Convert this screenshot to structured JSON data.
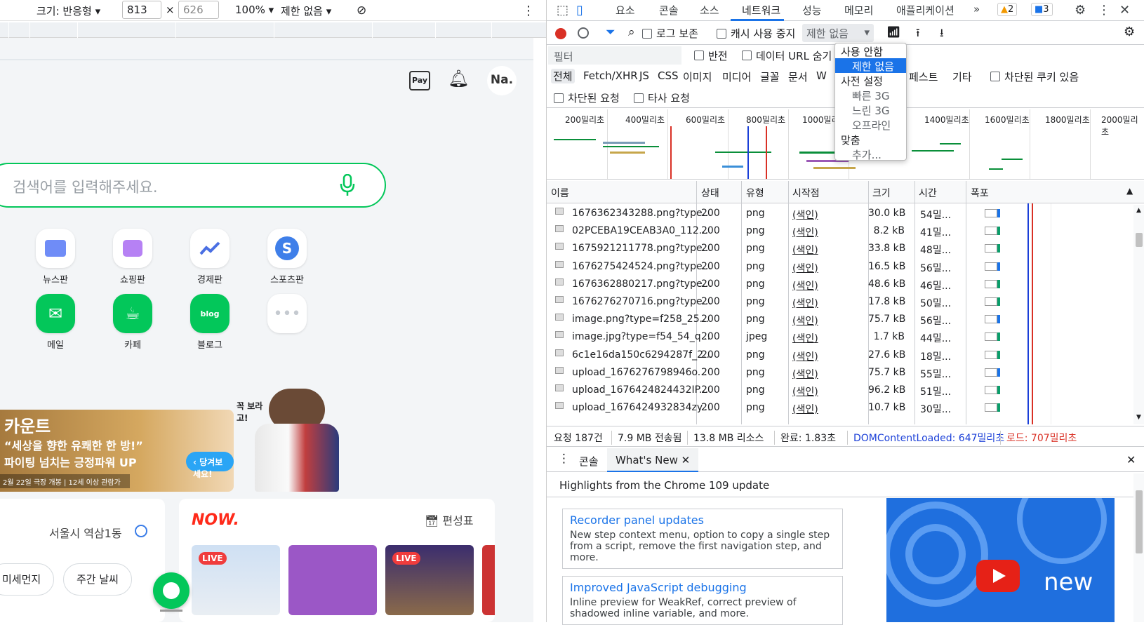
{
  "device_toolbar": {
    "size_label": "크기: 반응형",
    "width": "813",
    "x": "×",
    "height": "626",
    "zoom": "100%",
    "throttle": "제한 없음"
  },
  "page": {
    "pay_label": "Pay",
    "profile": "Na.",
    "search_placeholder": "검색어를 입력해주세요.",
    "apps": [
      {
        "label": "뉴스판",
        "icon": "news-icon"
      },
      {
        "label": "쇼핑판",
        "icon": "shopping-bag-icon"
      },
      {
        "label": "경제판",
        "icon": "chart-icon"
      },
      {
        "label": "스포츠판",
        "icon": "sports-icon"
      },
      {
        "label": "메일",
        "icon": "mail-icon"
      },
      {
        "label": "카페",
        "icon": "cafe-icon"
      },
      {
        "label": "블로그",
        "icon": "blog-icon"
      },
      {
        "label": "",
        "icon": "more-icon"
      }
    ],
    "banner": {
      "brand": "카운트",
      "line1": "“세상을 향한 유쾌한 한 방!”",
      "line2": "파이팅 넘치는 긍정파워 UP",
      "footer": "2월 22일 극장 개봉 | 12세 이상 관람가",
      "cta": "당겨보세요!",
      "side": "꼭 보라고!"
    },
    "weather": {
      "location": "서울시 역삼1동",
      "btn1": "미세먼지",
      "btn2": "주간 날씨"
    },
    "now": {
      "logo": "NOW.",
      "schedule": "편성표",
      "live": "LIVE"
    }
  },
  "devtools": {
    "tabs": [
      "요소",
      "콘솔",
      "소스",
      "네트워크",
      "성능",
      "메모리",
      "애플리케이션"
    ],
    "warnings": "2",
    "messages": "3",
    "netbar": {
      "preserve_log": "로그 보존",
      "disable_cache": "캐시 사용 중지",
      "throttle": "제한 없음"
    },
    "filter": {
      "placeholder": "필터",
      "invert": "반전",
      "hide_data": "데이터 URL 숨기"
    },
    "types": [
      "전체",
      "Fetch/XHR",
      "JS",
      "CSS",
      "이미지",
      "미디어",
      "글꼴",
      "문서",
      "W"
    ],
    "types_tail": [
      "페스트",
      "기타"
    ],
    "blocked_cookies": "차단된 쿠키 있음",
    "blocked_requests": "차단된 요청",
    "third_party": "타사 요청",
    "timeline_ticks": [
      "200밀리초",
      "400밀리초",
      "600밀리초",
      "800밀리초",
      "1000밀리초",
      "1400밀리초",
      "1600밀리초",
      "1800밀리초",
      "2000밀리초"
    ],
    "columns": [
      "이름",
      "상태",
      "유형",
      "시작점",
      "크기",
      "시간",
      "폭포"
    ],
    "rows": [
      {
        "name": "1676362343288.png?type...",
        "status": "200",
        "type": "png",
        "initiator": "(색인)",
        "size": "30.0 kB",
        "time": "54밀..."
      },
      {
        "name": "02PCEBA19CEAB3A0_112...",
        "status": "200",
        "type": "png",
        "initiator": "(색인)",
        "size": "8.2 kB",
        "time": "41밀..."
      },
      {
        "name": "1675921211778.png?type...",
        "status": "200",
        "type": "png",
        "initiator": "(색인)",
        "size": "33.8 kB",
        "time": "48밀..."
      },
      {
        "name": "1676275424524.png?type...",
        "status": "200",
        "type": "png",
        "initiator": "(색인)",
        "size": "16.5 kB",
        "time": "56밀..."
      },
      {
        "name": "1676362880217.png?type...",
        "status": "200",
        "type": "png",
        "initiator": "(색인)",
        "size": "48.6 kB",
        "time": "46밀..."
      },
      {
        "name": "1676276270716.png?type...",
        "status": "200",
        "type": "png",
        "initiator": "(색인)",
        "size": "17.8 kB",
        "time": "50밀..."
      },
      {
        "name": "image.png?type=f258_25...",
        "status": "200",
        "type": "png",
        "initiator": "(색인)",
        "size": "75.7 kB",
        "time": "56밀..."
      },
      {
        "name": "image.jpg?type=f54_54_q...",
        "status": "200",
        "type": "jpeg",
        "initiator": "(색인)",
        "size": "1.7 kB",
        "time": "44밀..."
      },
      {
        "name": "6c1e16da150c6294287f_2...",
        "status": "200",
        "type": "png",
        "initiator": "(색인)",
        "size": "27.6 kB",
        "time": "18밀..."
      },
      {
        "name": "upload_1676276798946o...",
        "status": "200",
        "type": "png",
        "initiator": "(색인)",
        "size": "75.7 kB",
        "time": "55밀..."
      },
      {
        "name": "upload_1676424824432IP...",
        "status": "200",
        "type": "png",
        "initiator": "(색인)",
        "size": "96.2 kB",
        "time": "51밀..."
      },
      {
        "name": "upload_1676424932834zy...",
        "status": "200",
        "type": "png",
        "initiator": "(색인)",
        "size": "10.7 kB",
        "time": "30밀..."
      }
    ],
    "summary": {
      "requests": "요청 187건",
      "transferred": "7.9 MB 전송됨",
      "resources": "13.8 MB 리소스",
      "finish": "완료: 1.83초",
      "dcl": "DOMContentLoaded: 647밀리초",
      "load": "로드: 707밀리초"
    },
    "drawer": {
      "console": "콘솔",
      "whats_new": "What's New"
    },
    "highlights": "Highlights from the Chrome 109 update",
    "features": [
      {
        "title": "Recorder panel updates",
        "desc": "New step context menu, option to copy a single step from a script, remove the first navigation step, and more."
      },
      {
        "title": "Improved JavaScript debugging",
        "desc": "Inline preview for WeakRef, correct preview of shadowed inline variable, and more."
      }
    ],
    "video_label": "new",
    "dropdown": [
      {
        "label": "사용 안함",
        "kind": "header"
      },
      {
        "label": "제한 없음",
        "kind": "selected"
      },
      {
        "label": "사전 설정",
        "kind": "header"
      },
      {
        "label": "빠른 3G",
        "kind": "item"
      },
      {
        "label": "느린 3G",
        "kind": "item"
      },
      {
        "label": "오프라인",
        "kind": "item"
      },
      {
        "label": "맞춤",
        "kind": "header"
      },
      {
        "label": "추가...",
        "kind": "item"
      }
    ]
  },
  "colors": {
    "naver_green": "#03c75a",
    "devtools_blue": "#1a73e8",
    "load_red": "#d93025"
  }
}
